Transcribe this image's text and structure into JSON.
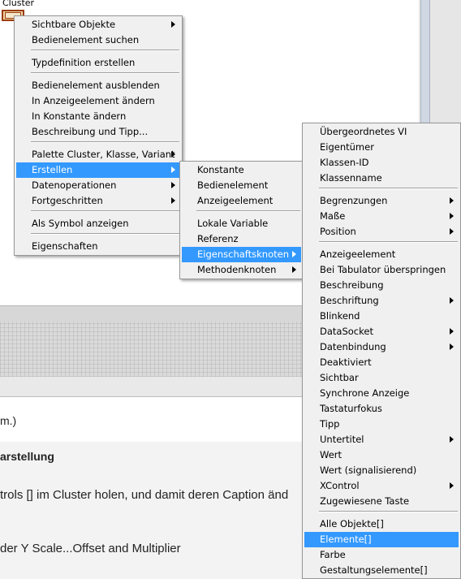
{
  "panel": {
    "cluster_label": "Cluster"
  },
  "menu1": {
    "items": [
      {
        "label": "Sichtbare Objekte",
        "submenu": true
      },
      {
        "label": "Bedienelement suchen",
        "submenu": false
      },
      {
        "label": "Typdefinition erstellen",
        "submenu": false
      },
      {
        "label": "Bedienelement ausblenden",
        "submenu": false
      },
      {
        "label": "In Anzeigeelement ändern",
        "submenu": false
      },
      {
        "label": "In Konstante ändern",
        "submenu": false
      },
      {
        "label": "Beschreibung und Tipp...",
        "submenu": false
      },
      {
        "label": "Palette Cluster, Klasse, Variant",
        "submenu": true
      },
      {
        "label": "Erstellen",
        "submenu": true,
        "highlighted": true
      },
      {
        "label": "Datenoperationen",
        "submenu": true
      },
      {
        "label": "Fortgeschritten",
        "submenu": true
      },
      {
        "label": "Als Symbol anzeigen",
        "submenu": false
      },
      {
        "label": "Eigenschaften",
        "submenu": false
      }
    ]
  },
  "menu2": {
    "items": [
      {
        "label": "Konstante",
        "submenu": false
      },
      {
        "label": "Bedienelement",
        "submenu": false
      },
      {
        "label": "Anzeigeelement",
        "submenu": false
      },
      {
        "label": "Lokale Variable",
        "submenu": false
      },
      {
        "label": "Referenz",
        "submenu": false
      },
      {
        "label": "Eigenschaftsknoten",
        "submenu": true,
        "highlighted": true
      },
      {
        "label": "Methodenknoten",
        "submenu": true
      }
    ]
  },
  "menu3": {
    "items": [
      {
        "label": "Übergeordnetes VI",
        "submenu": false
      },
      {
        "label": "Eigentümer",
        "submenu": false
      },
      {
        "label": "Klassen-ID",
        "submenu": false
      },
      {
        "label": "Klassenname",
        "submenu": false
      },
      {
        "label": "Begrenzungen",
        "submenu": true
      },
      {
        "label": "Maße",
        "submenu": true
      },
      {
        "label": "Position",
        "submenu": true
      },
      {
        "label": "Anzeigeelement",
        "submenu": false
      },
      {
        "label": "Bei Tabulator überspringen",
        "submenu": false
      },
      {
        "label": "Beschreibung",
        "submenu": false
      },
      {
        "label": "Beschriftung",
        "submenu": true
      },
      {
        "label": "Blinkend",
        "submenu": false
      },
      {
        "label": "DataSocket",
        "submenu": true
      },
      {
        "label": "Datenbindung",
        "submenu": true
      },
      {
        "label": "Deaktiviert",
        "submenu": false
      },
      {
        "label": "Sichtbar",
        "submenu": false
      },
      {
        "label": "Synchrone Anzeige",
        "submenu": false
      },
      {
        "label": "Tastaturfokus",
        "submenu": false
      },
      {
        "label": "Tipp",
        "submenu": false
      },
      {
        "label": "Untertitel",
        "submenu": true
      },
      {
        "label": "Wert",
        "submenu": false
      },
      {
        "label": "Wert (signalisierend)",
        "submenu": false
      },
      {
        "label": "XControl",
        "submenu": true
      },
      {
        "label": "Zugewiesene Taste",
        "submenu": false
      },
      {
        "label": "Alle Objekte[]",
        "submenu": false
      },
      {
        "label": "Elemente[]",
        "submenu": false,
        "highlighted": true
      },
      {
        "label": "Farbe",
        "submenu": false
      },
      {
        "label": "Gestaltungselemente[]",
        "submenu": false
      }
    ]
  },
  "document": {
    "line1": "m.)",
    "line2": "arstellung",
    "line3": "trols [] im Cluster holen, und damit deren Caption änd",
    "line4": "der Y Scale...Offset and Multiplier"
  },
  "colors": {
    "highlight": "#3399ff",
    "menu_bg": "#f0f0f0",
    "cluster_border": "#9b3b0c"
  }
}
